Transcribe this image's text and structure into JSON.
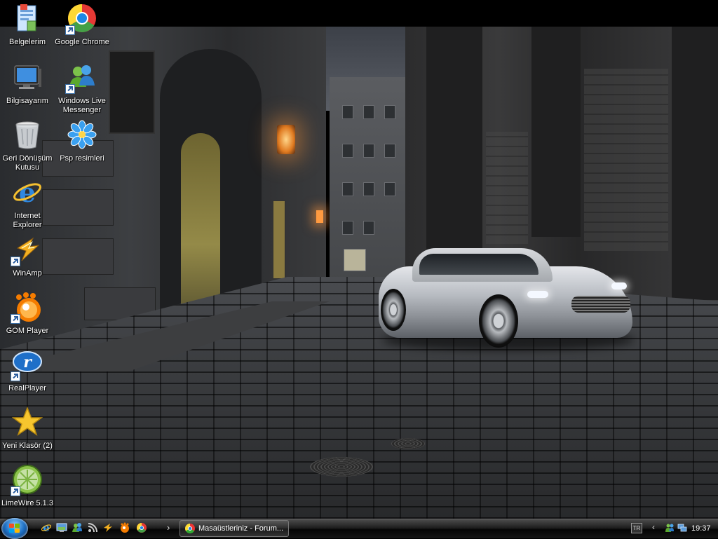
{
  "desktop": {
    "icons": [
      {
        "label": "Belgelerim"
      },
      {
        "label": "Google Chrome"
      },
      {
        "label": "Bilgisayarım"
      },
      {
        "label": "Windows Live Messenger"
      },
      {
        "label": "Geri Dönüşüm Kutusu"
      },
      {
        "label": "Psp resimleri"
      },
      {
        "label": "Internet Explorer"
      },
      {
        "label": "WinAmp"
      },
      {
        "label": "GOM Player"
      },
      {
        "label": "RealPlayer"
      },
      {
        "label": "Yeni Klasör (2)"
      },
      {
        "label": "LimeWire 5.1.3"
      }
    ]
  },
  "taskbar": {
    "quick_launch": [
      "internet-explorer-icon",
      "show-desktop-icon",
      "messenger-icon",
      "rss-icon",
      "winamp-icon",
      "gom-player-icon",
      "chrome-icon"
    ],
    "chevron": "›",
    "window_button": "Masaüstleriniz - Forum...",
    "tray": {
      "language": "TR",
      "expand": "‹",
      "clock": "19:37"
    }
  },
  "colors": {
    "taskbar": "#1e1e1e",
    "icon_text": "#ffffff"
  }
}
